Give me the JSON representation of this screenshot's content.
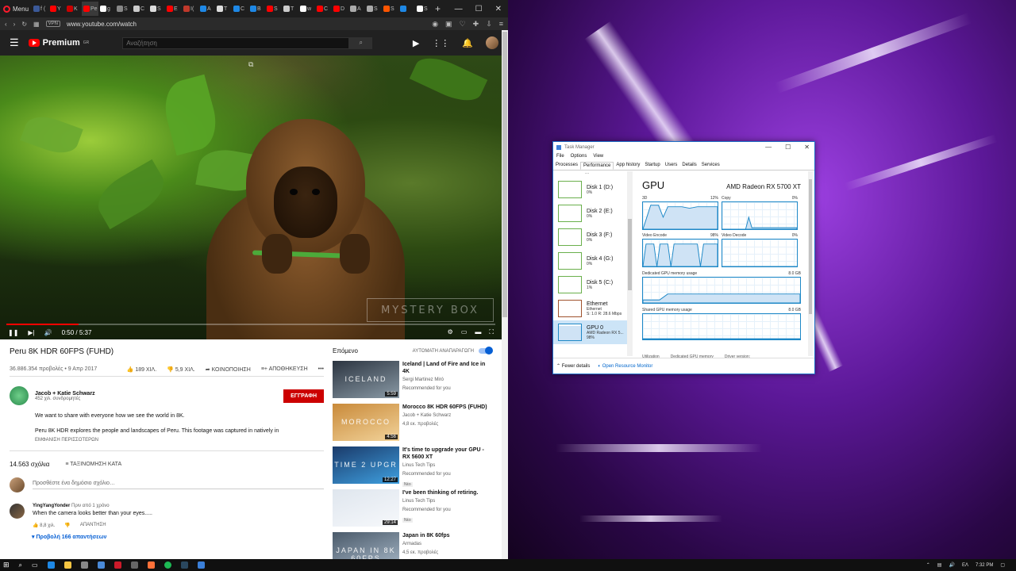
{
  "browser": {
    "menu_label": "Menu",
    "tabs": [
      {
        "label": "f (",
        "color": "#3b5998"
      },
      {
        "label": "Y",
        "color": "#ff0000"
      },
      {
        "label": "K",
        "color": "#cc0000"
      },
      {
        "label": "Pe",
        "color": "#ff0000",
        "active": true
      },
      {
        "label": "g",
        "color": "#ffffff"
      },
      {
        "label": "S",
        "color": "#888888"
      },
      {
        "label": "C",
        "color": "#cccccc"
      },
      {
        "label": "S",
        "color": "#dddddd"
      },
      {
        "label": "E",
        "color": "#ff0000"
      },
      {
        "label": "I(",
        "color": "#c0392b"
      },
      {
        "label": "A",
        "color": "#1e88e5"
      },
      {
        "label": "T",
        "color": "#dddddd"
      },
      {
        "label": "C",
        "color": "#1e88e5"
      },
      {
        "label": "B",
        "color": "#1e88e5"
      },
      {
        "label": "S",
        "color": "#ff0000"
      },
      {
        "label": "T",
        "color": "#cccccc"
      },
      {
        "label": "w",
        "color": "#ffffff"
      },
      {
        "label": "C",
        "color": "#ff0000"
      },
      {
        "label": "D",
        "color": "#ff0000"
      },
      {
        "label": "A",
        "color": "#aaaaaa"
      },
      {
        "label": "S",
        "color": "#aaaaaa"
      },
      {
        "label": "S",
        "color": "#ff5500"
      },
      {
        "label": "",
        "color": "#1e88e5"
      },
      {
        "label": "S",
        "color": "#ffffff"
      }
    ],
    "url": "www.youtube.com/watch",
    "vpn_label": "VPN"
  },
  "youtube": {
    "logo_text": "Premium",
    "logo_region": "GR",
    "search_placeholder": "Αναζήτηση",
    "video": {
      "time": "0:50 / 5:37",
      "progress": 0.148,
      "watermark": "MYSTERY BOX",
      "title": "Peru 8K HDR 60FPS (FUHD)",
      "views_date": "36.886.354 προβολές • 9 Απρ 2017",
      "likes": "189 ΧΙΛ.",
      "dislikes": "5,9 ΧΙΛ.",
      "share": "ΚΟΙΝΟΠΟΙΗΣΗ",
      "save": "ΑΠΟΘΗΚΕΥΣΗ",
      "more": "•••"
    },
    "channel": {
      "name": "Jacob + Katie Schwarz",
      "subscribers": "452 χιλ. συνδρομητές",
      "subscribe": "ΕΓΓΡΑΦΗ"
    },
    "description": {
      "line1": "We want to share with everyone how we see the world in 8K.",
      "line2": "Peru 8K HDR explores the people and landscapes of Peru. This footage was captured in natively in",
      "show_more": "ΕΜΦΑΝΙΣΗ ΠΕΡΙΣΣΟΤΕΡΩΝ"
    },
    "comments": {
      "count": "14.563 σχόλια",
      "sort": "ΤΑΞΙΝΟΜΗΣΗ ΚΑΤΑ",
      "placeholder": "Προσθέστε ένα δημόσιο σχόλιο…",
      "first": {
        "author": "YingYangYonder",
        "time": "Πριν από 1 χρόνο",
        "text": "When the camera looks better than your eyes.....",
        "likes": "8,8 χιλ.",
        "reply": "ΑΠΑΝΤΗΣΗ",
        "view_replies": "Προβολή 166 απαντήσεων"
      }
    },
    "upnext": {
      "label": "Επόμενο",
      "autoplay": "ΑΥΤΟΜΑΤΗ ΑΝΑΠΑΡΑΓΩΓΗ",
      "items": [
        {
          "title": "Iceland | Land of Fire and Ice in 4K",
          "channel": "Sergi Martinez Miró",
          "meta": "Recommended for you",
          "duration": "5:59",
          "thumb_text": "ICELAND",
          "c1": "#2b3440",
          "c2": "#8a9aa6"
        },
        {
          "title": "Morocco 8K HDR 60FPS (FUHD)",
          "channel": "Jacob + Katie Schwarz",
          "meta": "4,8 εκ. προβολές",
          "duration": "4:56",
          "thumb_text": "MOROCCO",
          "c1": "#c98a3a",
          "c2": "#f2d39a"
        },
        {
          "title": "It's time to upgrade your GPU - RX 5600 XT",
          "channel": "Linus Tech Tips",
          "meta": "Recommended for you",
          "badge": "Νέο",
          "duration": "12:27",
          "thumb_text": "TIME 2 UPGR",
          "c1": "#1a3a6a",
          "c2": "#3fa0e0"
        },
        {
          "title": "I've been thinking of retiring.",
          "channel": "Linus Tech Tips",
          "meta": "Recommended for you",
          "badge": "Νέο",
          "duration": "29:14",
          "thumb_text": "",
          "c1": "#dfe6ee",
          "c2": "#f6f8fb"
        },
        {
          "title": "Japan in 8K 60fps",
          "channel": "Armadas",
          "meta": "4,5 εκ. προβολές",
          "duration": "",
          "thumb_text": "JAPAN IN 8K 60FPS",
          "c1": "#4a5a6a",
          "c2": "#a8b8c8"
        }
      ]
    }
  },
  "taskmanager": {
    "title": "Task Manager",
    "menu": [
      "File",
      "Options",
      "View"
    ],
    "tabs": [
      "Processes",
      "Performance",
      "App history",
      "Startup",
      "Users",
      "Details",
      "Services"
    ],
    "resources": [
      {
        "name": "Disk 1 (D:)",
        "value": "0%"
      },
      {
        "name": "Disk 2 (E:)",
        "value": "0%"
      },
      {
        "name": "Disk 3 (F:)",
        "value": "0%"
      },
      {
        "name": "Disk 4 (G:)",
        "value": "0%"
      },
      {
        "name": "Disk 5 (C:)",
        "value": "1%"
      },
      {
        "name": "Ethernet",
        "value": "Ethernet",
        "value2": "S: 1.0  R: 28.6 Mbps"
      },
      {
        "name": "GPU 0",
        "value": "AMD Radeon RX 5...",
        "value2": "98%"
      }
    ],
    "gpu": {
      "title": "GPU",
      "model": "AMD Radeon RX 5700 XT",
      "graphs": [
        {
          "name": "3D",
          "value": "12%"
        },
        {
          "name": "Copy",
          "value": "0%"
        },
        {
          "name": "Video Encode",
          "value": "98%"
        },
        {
          "name": "Video Decode",
          "value": "0%"
        }
      ],
      "dedicated_label": "Dedicated GPU memory usage",
      "dedicated_value": "8.0 GB",
      "shared_label": "Shared GPU memory usage",
      "shared_value": "8.0 GB",
      "footer_info": [
        "Utilization",
        "Dedicated GPU memory",
        "Driver version:"
      ]
    },
    "fewer_details": "Fewer details",
    "open_monitor": "Open Resource Monitor"
  },
  "taskbar": {
    "lang": "ΕΛ",
    "time": "7:32 PM"
  }
}
